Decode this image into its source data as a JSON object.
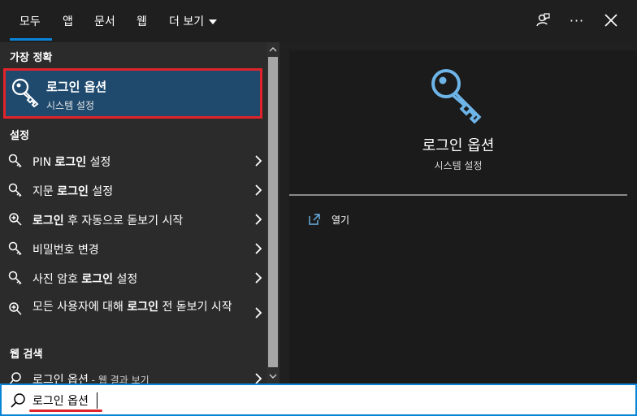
{
  "tabs": [
    {
      "label": "모두",
      "active": true
    },
    {
      "label": "앱"
    },
    {
      "label": "문서"
    },
    {
      "label": "웹"
    },
    {
      "label": "더 보기"
    }
  ],
  "top_icons": [
    "feedback-icon",
    "more-options-icon",
    "close-icon"
  ],
  "more_dots": "···",
  "best_match": {
    "header": "가장 정확",
    "title": "로그인 옵션",
    "subtitle": "시스템 설정"
  },
  "settings": {
    "header": "설정",
    "items": [
      {
        "pre": "PIN ",
        "bold": "로그인",
        "post": " 설정",
        "icon": "key-icon"
      },
      {
        "pre": "지문 ",
        "bold": "로그인",
        "post": " 설정",
        "icon": "key-icon"
      },
      {
        "pre": "",
        "bold": "로그인",
        "post": " 후 자동으로 돋보기 시작",
        "icon": "magnifier-icon"
      },
      {
        "pre": "비밀번호 변경",
        "bold": "",
        "post": "",
        "icon": "key-icon"
      },
      {
        "pre": "사진 암호 ",
        "bold": "로그인",
        "post": " 설정",
        "icon": "key-icon"
      },
      {
        "pre": "모든 사용자에 대해 ",
        "bold": "로그인",
        "post": " 전 돋보기 시작",
        "icon": "magnifier-icon"
      }
    ]
  },
  "web": {
    "header": "웹 검색",
    "item": {
      "pre": "로그인 옵션",
      "post": " - 웹 결과 보기"
    }
  },
  "detail": {
    "title": "로그인 옵션",
    "subtitle": "시스템 설정",
    "action_label": "열기"
  },
  "search": {
    "value": "로그인 옵션"
  },
  "colors": {
    "accent": "#0a84d6",
    "highlight_border": "#e0242b",
    "selected_bg": "#1f4a6e",
    "icon_blue": "#6db4e8"
  }
}
